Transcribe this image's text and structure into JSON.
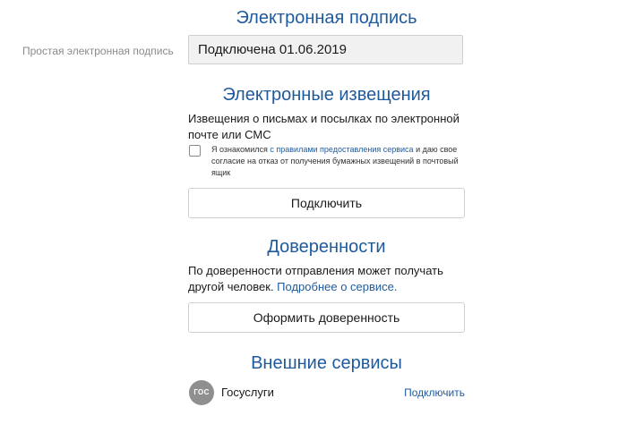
{
  "esign": {
    "title": "Электронная подпись",
    "label": "Простая электронная подпись",
    "value": "Подключена 01.06.2019"
  },
  "notifications": {
    "title": "Электронные извещения",
    "description": "Извещения о письмах и посылках по электронной почте или СМС",
    "consent_prefix": "Я ознакомился ",
    "consent_link": "с правилами предоставления сервиса",
    "consent_suffix": " и даю свое согласие на отказ от получения бумажных извещений в почтовый ящик",
    "checkbox_checked": false,
    "button_label": "Подключить"
  },
  "proxy": {
    "title": "Доверенности",
    "description": "По доверенности отправления может получать другой человек. ",
    "link": "Подробнее о сервисе.",
    "button_label": "Оформить доверенность"
  },
  "external": {
    "title": "Внешние сервисы",
    "items": [
      {
        "logo_text": "ГОС",
        "name": "Госуслуги",
        "action": "Подключить"
      }
    ]
  }
}
